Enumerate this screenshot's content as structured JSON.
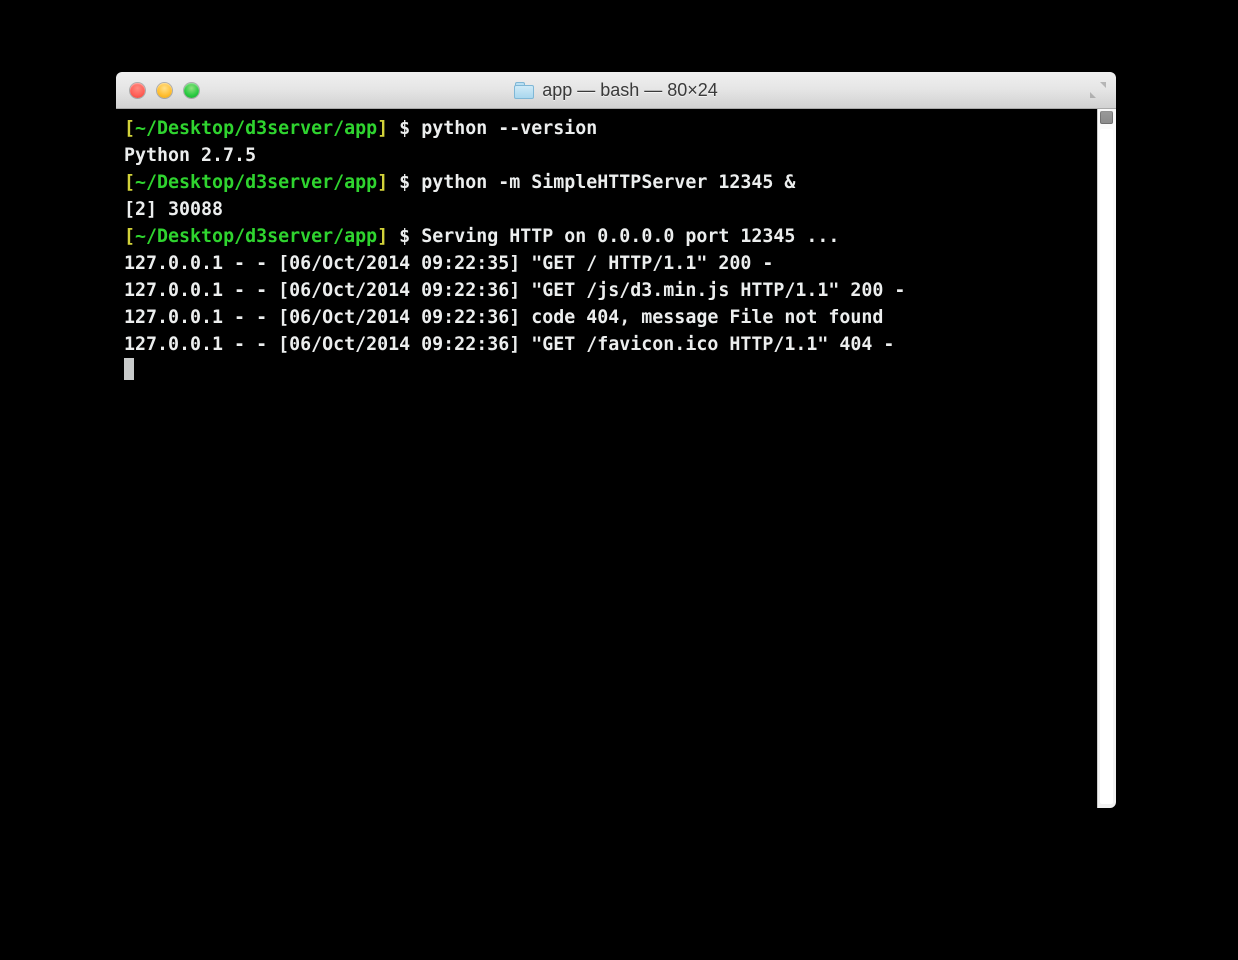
{
  "window": {
    "title": "app — bash — 80×24"
  },
  "prompt": {
    "open": "[",
    "path": "~/Desktop/d3server/app",
    "close": "]",
    "symbol": " $ "
  },
  "lines": [
    {
      "type": "prompt",
      "cmd": "python --version"
    },
    {
      "type": "out",
      "text": "Python 2.7.5"
    },
    {
      "type": "prompt",
      "cmd": "python -m SimpleHTTPServer 12345 &"
    },
    {
      "type": "out",
      "text": "[2] 30088"
    },
    {
      "type": "prompt",
      "cmd": "Serving HTTP on 0.0.0.0 port 12345 ..."
    },
    {
      "type": "out",
      "text": "127.0.0.1 - - [06/Oct/2014 09:22:35] \"GET / HTTP/1.1\" 200 -"
    },
    {
      "type": "out",
      "text": "127.0.0.1 - - [06/Oct/2014 09:22:36] \"GET /js/d3.min.js HTTP/1.1\" 200 -"
    },
    {
      "type": "out",
      "text": "127.0.0.1 - - [06/Oct/2014 09:22:36] code 404, message File not found"
    },
    {
      "type": "out",
      "text": "127.0.0.1 - - [06/Oct/2014 09:22:36] \"GET /favicon.ico HTTP/1.1\" 404 -"
    }
  ]
}
